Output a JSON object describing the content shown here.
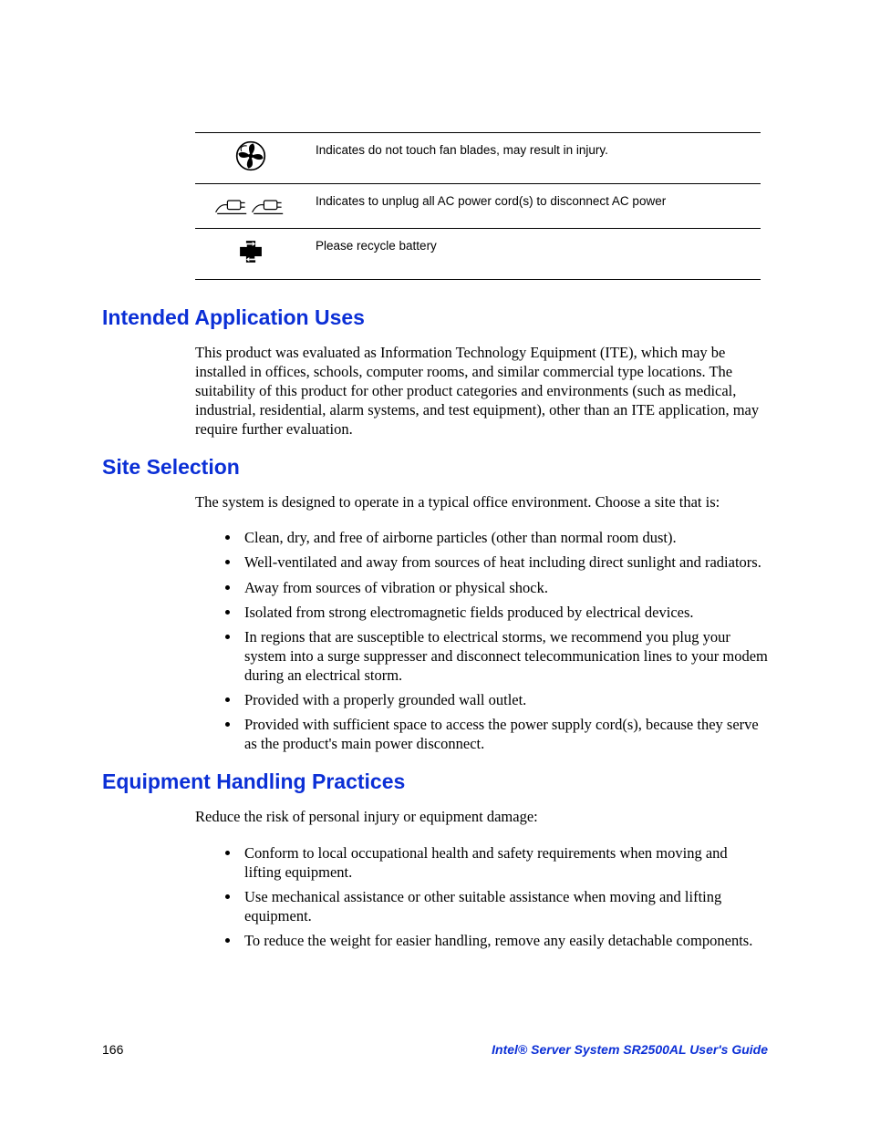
{
  "table": {
    "rows": [
      {
        "icon": "fan",
        "text": "Indicates do not touch fan blades, may result in injury."
      },
      {
        "icon": "plugs",
        "text": "Indicates to unplug all AC power cord(s) to disconnect AC power"
      },
      {
        "icon": "recycle",
        "text": "Please recycle battery"
      }
    ]
  },
  "sections": [
    {
      "heading": "Intended Application Uses",
      "paragraph": "This product was evaluated as Information Technology Equipment (ITE), which may be installed in offices, schools, computer rooms, and similar commercial type locations.  The suitability of this product for other product categories and environments (such as medical, industrial, residential, alarm systems, and test equipment), other than an ITE application, may require further evaluation."
    },
    {
      "heading": "Site Selection",
      "paragraph": "The system is designed to operate in a typical office environment.  Choose a site that is:",
      "bullets": [
        "Clean, dry, and free of airborne particles (other than normal room dust).",
        "Well-ventilated and away from sources of heat including direct sunlight and radiators.",
        "Away from sources of vibration or physical shock.",
        "Isolated from strong electromagnetic fields produced by electrical devices.",
        "In regions that are susceptible to electrical storms, we recommend you plug your system into a surge suppresser and disconnect telecommunication lines to your modem during an electrical storm.",
        "Provided with a properly grounded wall outlet.",
        "Provided with sufficient space to access the power supply cord(s), because they serve as the product's main power disconnect."
      ]
    },
    {
      "heading": "Equipment Handling Practices",
      "paragraph": "Reduce the risk of personal injury or equipment damage:",
      "bullets": [
        "Conform to local occupational health and safety requirements when moving and lifting equipment.",
        "Use mechanical assistance or other suitable assistance when moving and lifting equipment.",
        "To reduce the weight for easier handling, remove any easily detachable components."
      ]
    }
  ],
  "footer": {
    "page": "166",
    "title": "Intel® Server System SR2500AL User's Guide"
  }
}
